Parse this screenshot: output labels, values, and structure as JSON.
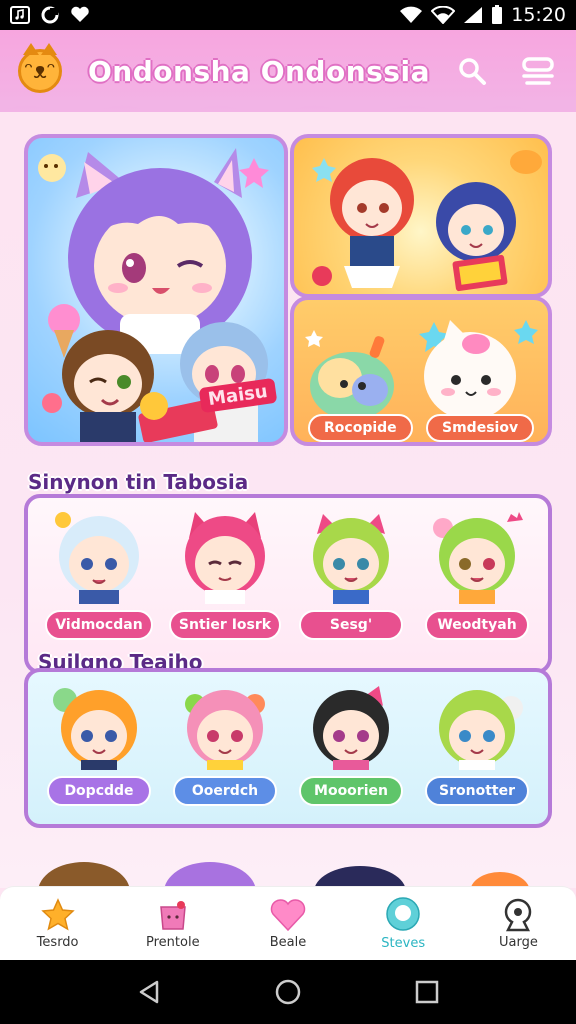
{
  "status_bar": {
    "time": "15:20"
  },
  "header": {
    "title": "Ondonsha Ondonssia"
  },
  "banners": {
    "main_label": "Maisu",
    "small_buttons": [
      "Rocopide",
      "Smdesiov"
    ]
  },
  "sections": [
    {
      "title": "Sinynon tin Tabosia",
      "items": [
        {
          "label": "Vidmocdan",
          "color": "#e8508f"
        },
        {
          "label": "Sntier Iosrk",
          "color": "#e8508f"
        },
        {
          "label": "Sesg'",
          "color": "#e8508f"
        },
        {
          "label": "Weodtyah",
          "color": "#e8508f"
        }
      ]
    },
    {
      "title": "Suilgno Teaiho",
      "items": [
        {
          "label": "Dopcdde",
          "color": "#a873e6"
        },
        {
          "label": "Ooerdch",
          "color": "#5d8ee6"
        },
        {
          "label": "Mooorien",
          "color": "#5fc56a"
        },
        {
          "label": "Sronotter",
          "color": "#4f82d9"
        }
      ]
    }
  ],
  "bottom_nav": [
    {
      "label": "Tesrdo",
      "icon": "star-icon"
    },
    {
      "label": "Prentole",
      "icon": "bag-icon"
    },
    {
      "label": "Beale",
      "icon": "heart-icon"
    },
    {
      "label": "Steves",
      "icon": "chat-icon",
      "active": true
    },
    {
      "label": "Uarge",
      "icon": "user-icon"
    }
  ]
}
